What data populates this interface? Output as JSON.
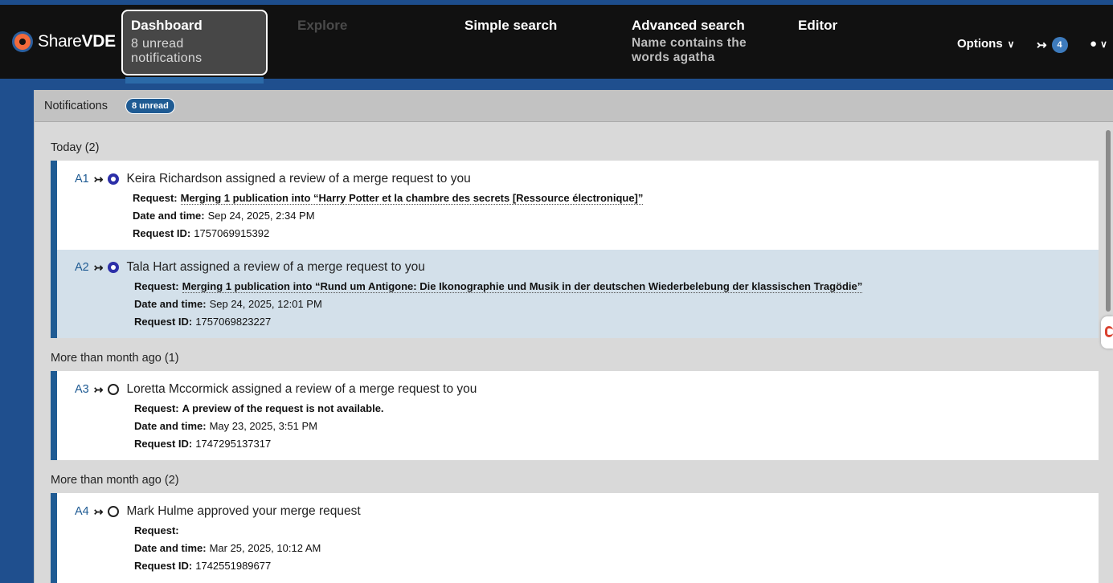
{
  "colors": {
    "accent": "#1f5b93",
    "brand_orange": "#f26a3b",
    "selected_row": "#d3e0ea"
  },
  "brand": {
    "prefix": "Share",
    "suffix": "VDE"
  },
  "nav": {
    "dashboard": {
      "label": "Dashboard",
      "sub": "8 unread notifications"
    },
    "explore": {
      "label": "Explore"
    },
    "simple": {
      "label": "Simple search"
    },
    "advanced": {
      "label": "Advanced search",
      "sub": "Name contains the words agatha"
    },
    "editor": {
      "label": "Editor"
    },
    "options": {
      "label": "Options"
    },
    "share_count": "4"
  },
  "panel": {
    "title": "Notifications",
    "badge": "8 unread"
  },
  "labels": {
    "request": "Request:",
    "date": "Date and time:",
    "id": "Request ID:"
  },
  "groups": [
    {
      "title": "Today (2)",
      "items": [
        {
          "code": "A1",
          "title": "Keira Richardson assigned a review of a merge request to you",
          "request": "Merging 1 publication into “Harry Potter et la chambre des secrets [Ressource électronique]”",
          "date": "Sep 24, 2025, 2:34 PM",
          "id": "1757069915392",
          "unread": true
        },
        {
          "code": "A2",
          "title": "Tala Hart assigned a review of a merge request to you",
          "request": "Merging 1 publication into “Rund um Antigone: Die Ikonographie und Musik in der deutschen Wiederbelebung der klassischen Tragödie”",
          "date": "Sep 24, 2025, 12:01 PM",
          "id": "1757069823227",
          "unread": true
        }
      ]
    },
    {
      "title": "More than month ago (1)",
      "items": [
        {
          "code": "A3",
          "title": "Loretta Mccormick assigned a review of a merge request to you",
          "request": "A preview of the request is not available.",
          "date": "May 23, 2025, 3:51 PM",
          "id": "1747295137317",
          "unread": false
        }
      ]
    },
    {
      "title": "More than month ago (2)",
      "items": [
        {
          "code": "A4",
          "title": "Mark Hulme approved your merge request",
          "request": "",
          "date": "Mar 25, 2025, 10:12 AM",
          "id": "1742551989677",
          "unread": false
        }
      ]
    }
  ]
}
